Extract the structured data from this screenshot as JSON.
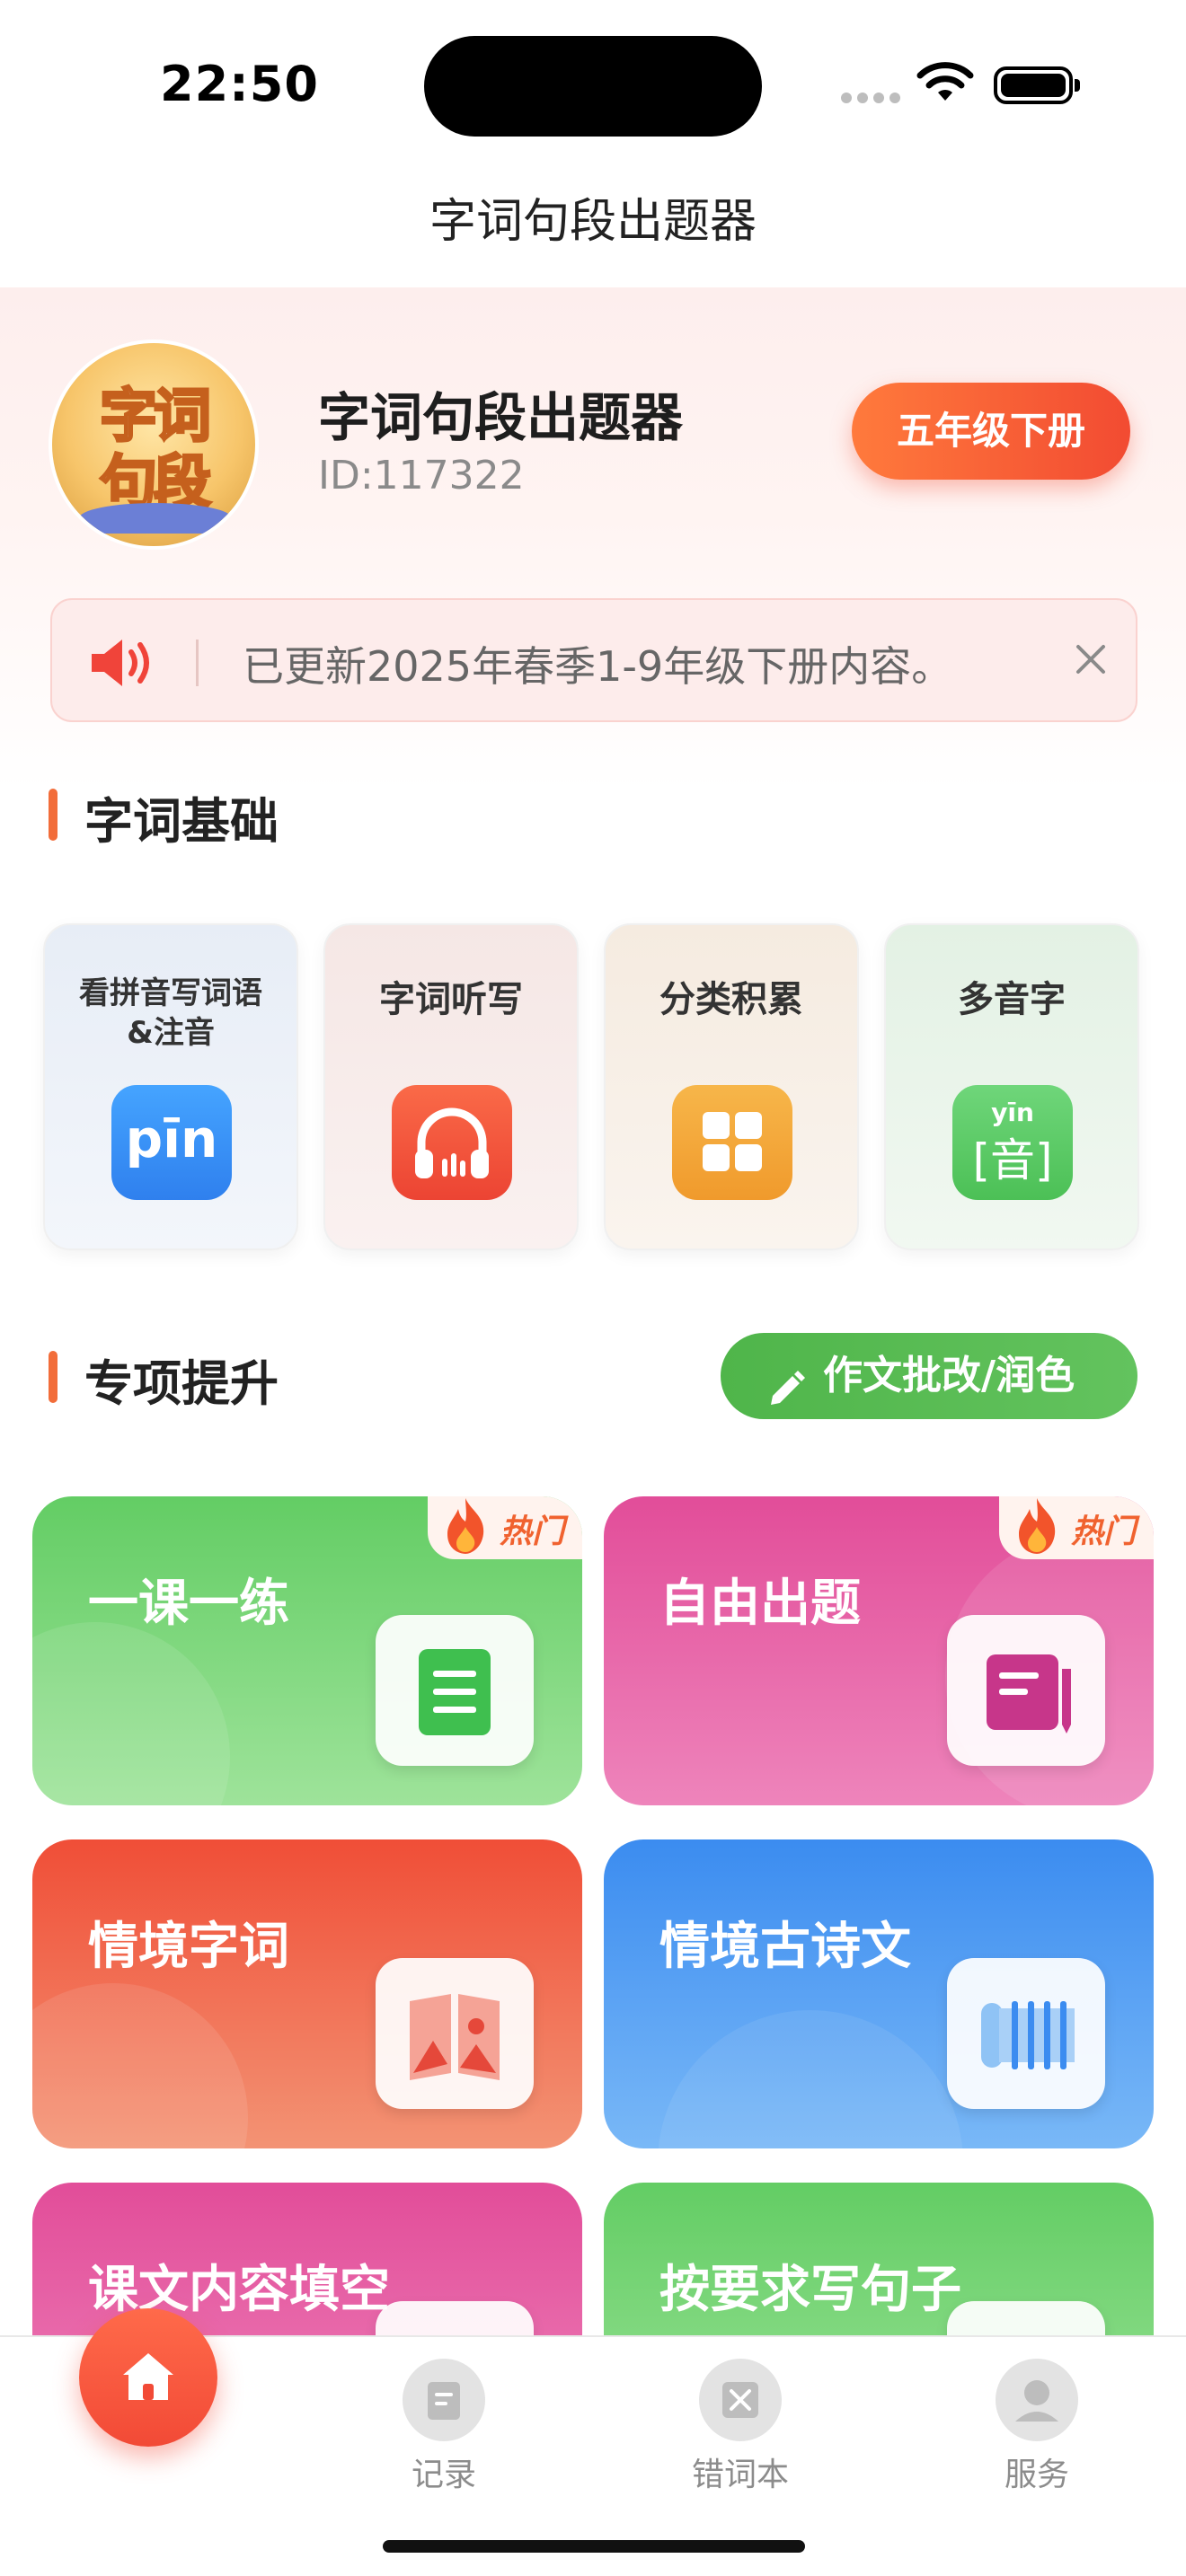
{
  "status_bar": {
    "time": "22:50"
  },
  "nav": {
    "title": "字词句段出题器"
  },
  "profile": {
    "name": "字词句段出题器",
    "id": "ID:117322",
    "avatar_text_top": "字词",
    "avatar_text_bottom": "句段",
    "grade_button": "五年级下册"
  },
  "notice": {
    "text": "已更新2025年春季1-9年级下册内容。",
    "icon": "speaker-icon",
    "close_icon": "close-icon"
  },
  "sections": {
    "basic": {
      "title": "字词基础",
      "tiles": [
        {
          "label": "看拼音写词语&注音",
          "label_line1": "看拼音写词语",
          "label_line2": "&注音",
          "icon": "pinyin-icon",
          "icon_text": "pīn",
          "color": "#3b8ff5"
        },
        {
          "label": "字词听写",
          "icon": "headphones-icon",
          "color": "#f04e3a"
        },
        {
          "label": "分类积累",
          "icon": "grid-icon",
          "color": "#f5a93a"
        },
        {
          "label": "多音字",
          "icon": "polyphone-icon",
          "icon_text_top": "yīn",
          "icon_text_main": "音",
          "color": "#5ccc5c"
        }
      ]
    },
    "special": {
      "title": "专项提升",
      "essay_button": "作文批改/润色",
      "cards": [
        {
          "title": "一课一练",
          "icon": "document-icon",
          "hot": true,
          "hot_label": "热门",
          "color": "#5fcd63"
        },
        {
          "title": "自由出题",
          "icon": "edit-note-icon",
          "hot": true,
          "hot_label": "热门",
          "color": "#e44f9c"
        },
        {
          "title": "情境字词",
          "icon": "picture-book-icon",
          "hot": false,
          "color": "#f0583a"
        },
        {
          "title": "情境古诗文",
          "icon": "scroll-icon",
          "hot": false,
          "color": "#3d8ef0"
        },
        {
          "title": "课文内容填空",
          "icon": "fill-blank-icon",
          "hot": false,
          "color": "#e44f9c"
        },
        {
          "title": "按要求写句子",
          "icon": "sentence-icon",
          "hot": false,
          "color": "#5fcd63"
        }
      ]
    }
  },
  "tabbar": {
    "items": [
      {
        "label": "",
        "icon": "home-icon",
        "active": true
      },
      {
        "label": "记录",
        "icon": "record-icon"
      },
      {
        "label": "错词本",
        "icon": "wrong-words-icon"
      },
      {
        "label": "服务",
        "icon": "service-icon"
      }
    ]
  }
}
